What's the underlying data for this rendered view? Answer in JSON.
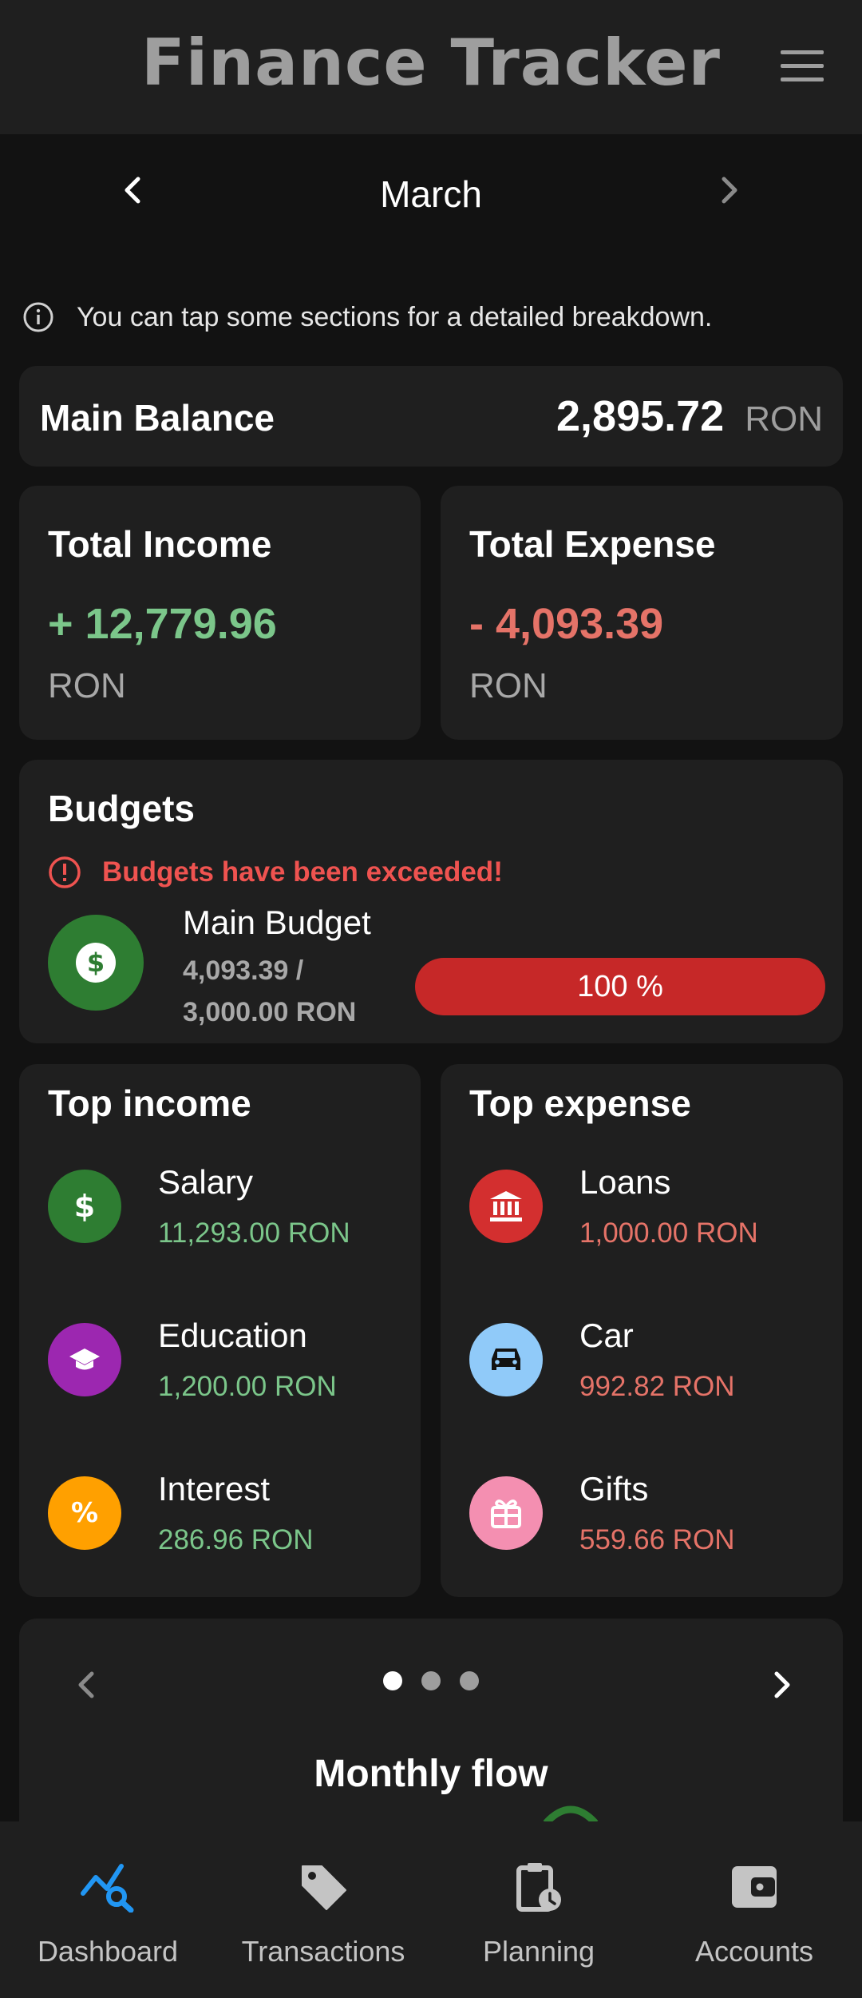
{
  "app": {
    "title": "Finance Tracker"
  },
  "month_nav": {
    "month": "March"
  },
  "hint": {
    "text": "You can tap some sections for a detailed breakdown."
  },
  "balance": {
    "label": "Main Balance",
    "value": "2,895.72",
    "currency": "RON"
  },
  "income": {
    "label": "Total Income",
    "value": "+ 12,779.96",
    "currency": "RON",
    "color": "#7bc68a"
  },
  "expense": {
    "label": "Total Expense",
    "value": "- 4,093.39",
    "currency": "RON",
    "color": "#e57368"
  },
  "budgets": {
    "title": "Budgets",
    "warning": "Budgets have been exceeded!",
    "item": {
      "name": "Main Budget",
      "amount_line1": "4,093.39 /",
      "amount_line2": "3,000.00 RON",
      "percent_label": "100 %",
      "progress": 1.0
    }
  },
  "top_income": {
    "title": "Top income",
    "items": [
      {
        "name": "Salary",
        "amount": "11,293.00 RON",
        "icon": "dollar-icon",
        "color": "#2e7d32"
      },
      {
        "name": "Education",
        "amount": "1,200.00 RON",
        "icon": "graduation-cap-icon",
        "color": "#9c27b0"
      },
      {
        "name": "Interest",
        "amount": "286.96 RON",
        "icon": "percent-icon",
        "color": "#ffa000"
      }
    ]
  },
  "top_expense": {
    "title": "Top expense",
    "items": [
      {
        "name": "Loans",
        "amount": "1,000.00 RON",
        "icon": "bank-icon",
        "color": "#d32f2f"
      },
      {
        "name": "Car",
        "amount": "992.82 RON",
        "icon": "car-icon",
        "color": "#90caf9"
      },
      {
        "name": "Gifts",
        "amount": "559.66 RON",
        "icon": "gift-icon",
        "color": "#f48fb1"
      }
    ]
  },
  "chart_card": {
    "title": "Monthly flow",
    "page_count": 3,
    "active_page": 1
  },
  "bottom_nav": {
    "items": [
      {
        "label": "Dashboard",
        "icon": "dashboard-chart-icon",
        "active": true
      },
      {
        "label": "Transactions",
        "icon": "tag-icon",
        "active": false
      },
      {
        "label": "Planning",
        "icon": "clipboard-clock-icon",
        "active": false
      },
      {
        "label": "Accounts",
        "icon": "wallet-icon",
        "active": false
      }
    ]
  },
  "colors": {
    "accent": "#2196f3",
    "income_green": "#7bc68a",
    "expense_red": "#e57368",
    "warning": "#ef5350",
    "surface": "#1f1f1f",
    "background": "#121212"
  }
}
